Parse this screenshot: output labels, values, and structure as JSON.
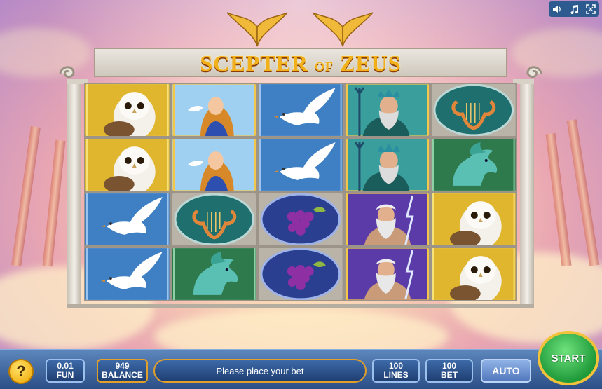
{
  "game": {
    "title_part1": "SCEPTER",
    "title_part2": "OF",
    "title_part3": "ZEUS"
  },
  "utility_bar": {
    "icons": [
      "speaker-icon",
      "music-icon",
      "fullscreen-icon"
    ]
  },
  "reels": [
    [
      "owl",
      "owl",
      "dove",
      "dove"
    ],
    [
      "goddess",
      "goddess",
      "lyre",
      "horse"
    ],
    [
      "dove",
      "dove",
      "grapes",
      "grapes"
    ],
    [
      "poseidon",
      "poseidon",
      "zeus",
      "zeus"
    ],
    [
      "lyre",
      "horse",
      "owl",
      "owl"
    ]
  ],
  "controls": {
    "help_label": "?",
    "coin_value": "0.01",
    "coin_label": "FUN",
    "balance_value": "949",
    "balance_label": "BALANCE",
    "message": "Please place your bet",
    "lines_value": "100",
    "lines_label": "LINES",
    "bet_value": "100",
    "bet_label": "BET",
    "auto_label": "AUTO",
    "start_label": "START"
  },
  "colors": {
    "panel_blue": "#2b4f86",
    "gold_accent": "#e2a028",
    "start_green": "#1f9a3a"
  }
}
